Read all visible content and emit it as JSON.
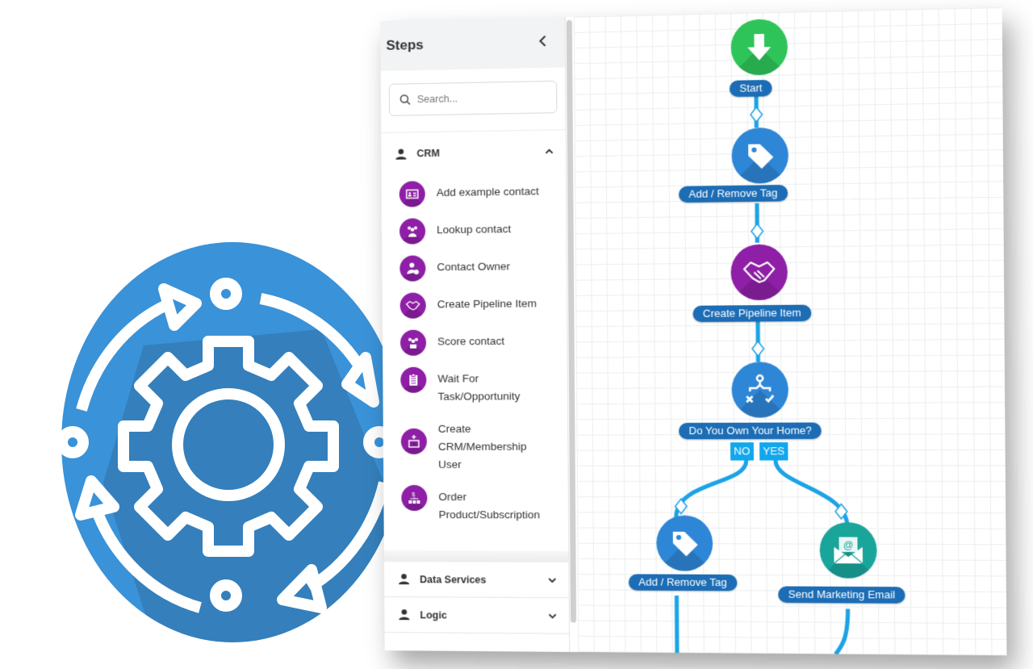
{
  "sidebar": {
    "title": "Steps",
    "collapse_icon": "chevron-left-icon",
    "search": {
      "placeholder": "Search...",
      "value": ""
    },
    "groups": [
      {
        "label": "CRM",
        "expanded": true,
        "items": [
          {
            "label": "Add example contact",
            "icon": "contact-card-icon"
          },
          {
            "label": "Lookup contact",
            "icon": "contact-group-icon"
          },
          {
            "label": "Contact Owner",
            "icon": "contact-owner-icon"
          },
          {
            "label": "Create Pipeline Item",
            "icon": "handshake-icon"
          },
          {
            "label": "Score contact",
            "icon": "score-contact-icon"
          },
          {
            "label": "Wait For Task/Opportunity",
            "icon": "clipboard-checklist-icon"
          },
          {
            "label": "Create CRM/Membership User",
            "icon": "add-user-card-icon"
          },
          {
            "label": "Order Product/Subscription",
            "icon": "order-product-icon"
          }
        ]
      },
      {
        "label": "Data Services",
        "expanded": false
      },
      {
        "label": "Logic",
        "expanded": false
      }
    ]
  },
  "canvas": {
    "nodes": [
      {
        "id": "start",
        "label": "Start",
        "icon": "arrow-down-icon",
        "color": "#2fc45a"
      },
      {
        "id": "tag1",
        "label": "Add / Remove Tag",
        "icon": "tag-icon",
        "color": "#2e86d6"
      },
      {
        "id": "pipeline",
        "label": "Create Pipeline Item",
        "icon": "handshake-icon",
        "color": "#8e1fa6"
      },
      {
        "id": "decision",
        "label": "Do You Own Your Home?",
        "icon": "decision-split-icon",
        "color": "#2e86d6"
      },
      {
        "id": "tag2",
        "label": "Add / Remove Tag",
        "icon": "tag-icon",
        "color": "#2e86d6"
      },
      {
        "id": "email",
        "label": "Send Marketing Email",
        "icon": "email-open-icon",
        "color": "#1aa59b"
      }
    ],
    "branches": {
      "no": "NO",
      "yes": "YES"
    }
  },
  "colors": {
    "logo_blue": "#3a92d8",
    "crm_purple": "#8e1fa6",
    "label_blue": "#1c6db5",
    "connector_blue": "#1ba3e6",
    "branch_tag": "#11a7ec"
  }
}
